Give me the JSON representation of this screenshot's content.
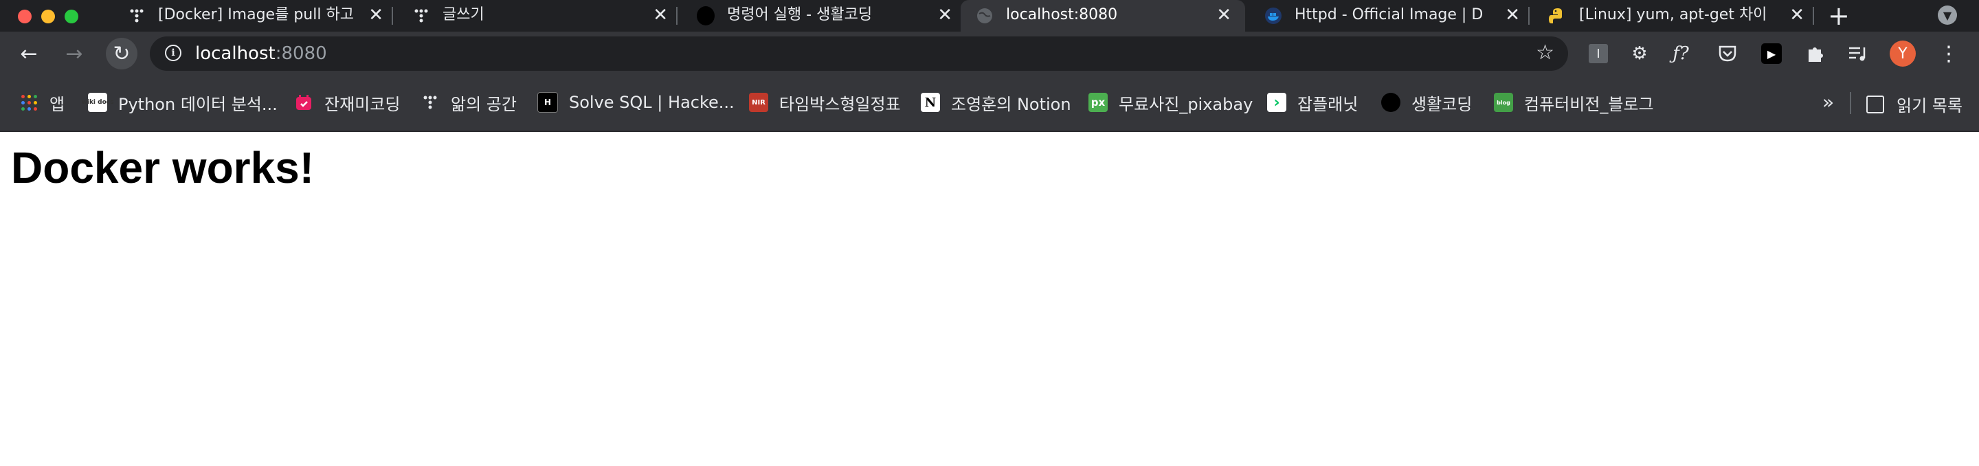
{
  "tabs": [
    {
      "title": "[Docker] Image를 pull 하고",
      "icon": "tistory-dots-icon",
      "active": false
    },
    {
      "title": "글쓰기",
      "icon": "tistory-dots-icon",
      "active": false
    },
    {
      "title": "명령어 실행 - 생활코딩",
      "icon": "black-circle-icon",
      "active": false
    },
    {
      "title": "localhost:8080",
      "icon": "globe-icon",
      "active": true
    },
    {
      "title": "Httpd - Official Image | D",
      "icon": "docker-whale-icon",
      "active": false
    },
    {
      "title": "[Linux] yum, apt-get 차이",
      "icon": "python-icon",
      "active": false
    }
  ],
  "omnibox": {
    "host": "localhost",
    "port": ":8080"
  },
  "bookmarks": [
    {
      "label": "앱",
      "icon": "apps-grid-icon",
      "color": "#ea4335"
    },
    {
      "label": "Python 데이터 분석...",
      "icon": "wikidocs-icon",
      "icon_text": "wiki docs",
      "color": "#ffffff"
    },
    {
      "label": "잔재미코딩",
      "icon": "calendar-icon",
      "color": "#e91e63"
    },
    {
      "label": "앎의 공간",
      "icon": "tistory-dots-icon",
      "color": "#e8eaed"
    },
    {
      "label": "Solve SQL | Hacke...",
      "icon": "hackerrank-icon",
      "icon_text": "H",
      "color": "#000000"
    },
    {
      "label": "타임박스형일정표",
      "icon": "nir-icon",
      "icon_text": "NIR",
      "color": "#c0392b"
    },
    {
      "label": "조영훈의 Notion",
      "icon": "notion-icon",
      "icon_text": "N",
      "color": "#ffffff"
    },
    {
      "label": "무료사진_pixabay",
      "icon": "pixabay-icon",
      "icon_text": "px",
      "color": "#4caf50"
    },
    {
      "label": "잡플래닛",
      "icon": "jobplanet-icon",
      "icon_text": "›",
      "color": "#00c362"
    },
    {
      "label": "생활코딩",
      "icon": "black-circle-icon",
      "color": "#000000"
    },
    {
      "label": "컴퓨터비전_블로그",
      "icon": "blog-icon",
      "icon_text": "blog",
      "color": "#43a047"
    }
  ],
  "reading_list": "읽기 목록",
  "more_bookmarks": "»",
  "avatar_letter": "Y",
  "page": {
    "heading": "Docker works!"
  }
}
